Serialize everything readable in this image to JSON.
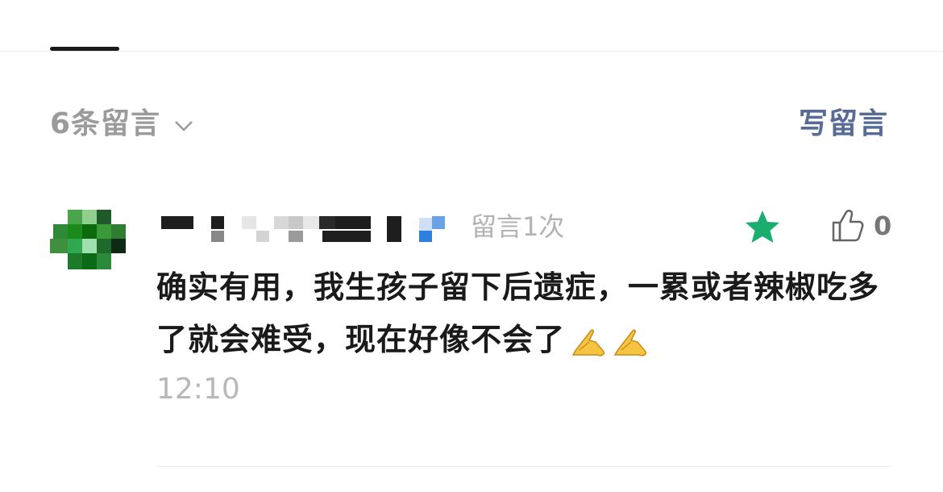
{
  "comments_header": {
    "count_label": "6条留言",
    "write_label": "写留言"
  },
  "comment": {
    "meta": "留言1次",
    "content": "确实有用，我生孩子留下后遗症，一累或者辣椒吃多了就会难受，现在好像不会了",
    "emoji_names": [
      "folded-hands-emoji",
      "folded-hands-emoji"
    ],
    "time": "12:10",
    "like_count": "0",
    "starred": true,
    "avatar": "pixelated",
    "nickname": "pixelated"
  },
  "colors": {
    "link": "#576b95",
    "muted": "#9b9b9b",
    "star": "#1aad6e",
    "text": "#1a1a1a"
  }
}
